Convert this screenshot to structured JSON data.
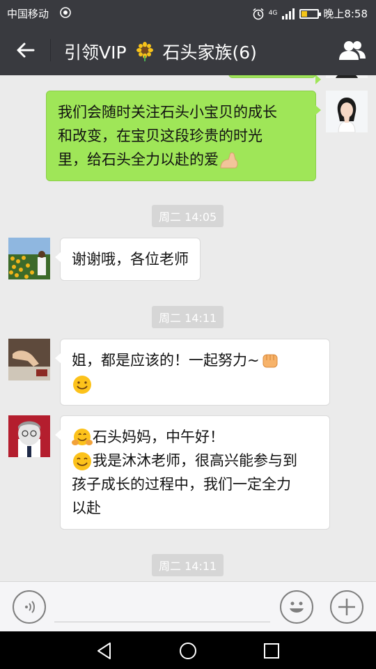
{
  "status_bar": {
    "carrier": "中国移动",
    "network": "4G",
    "time": "晚上8:58",
    "battery_level": 0.3
  },
  "header": {
    "title_prefix": "引领VIP",
    "title_emoji": "sunflower",
    "title_suffix": "石头家族(6)"
  },
  "messages": [
    {
      "type": "outgoing",
      "lines": [
        "我们会随时关注石头小宝贝的成长",
        "和改变，在宝贝这段珍贵的时光",
        "里，给石头全力以赴的爱"
      ],
      "trailing_emoji": "flexed-biceps"
    },
    {
      "type": "time",
      "text": "周二 14:05"
    },
    {
      "type": "incoming",
      "lines": [
        "谢谢哦，各位老师"
      ]
    },
    {
      "type": "time",
      "text": "周二 14:11"
    },
    {
      "type": "incoming",
      "lines": [
        "姐，都是应该的！一起努力~"
      ],
      "emojis": [
        "raised-fist",
        "smiling-face"
      ]
    },
    {
      "type": "incoming",
      "lines": [
        "石头妈妈，中午好！",
        "我是沐沐老师，很高兴能参与到",
        "孩子成长的过程中，我们一定全力",
        "以赴"
      ],
      "emojis": [
        "hugging-face",
        "smiling-face"
      ]
    },
    {
      "type": "time",
      "text": "周二 14:11"
    }
  ],
  "colors": {
    "bar_bg": "#393a3f",
    "chat_bg": "#ebebeb",
    "outgoing_bubble": "#9fe658",
    "incoming_bubble": "#ffffff"
  }
}
